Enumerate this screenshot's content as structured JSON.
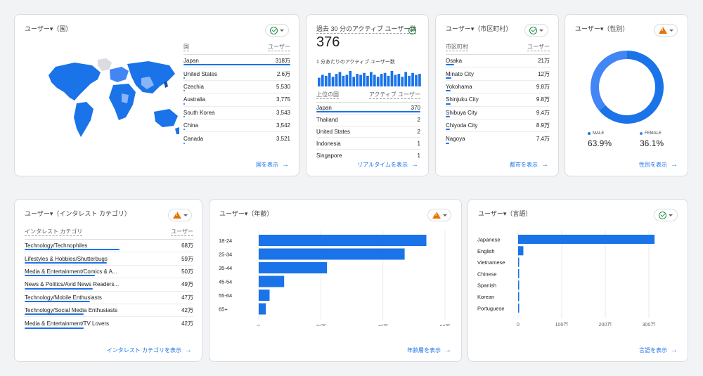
{
  "country_card": {
    "title": "ユーザー▾（国）",
    "header": [
      "国",
      "ユーザー"
    ],
    "rows": [
      {
        "name": "Japan",
        "value": "318万",
        "share": 1.0
      },
      {
        "name": "United States",
        "value": "2.6万",
        "share": 0.01
      },
      {
        "name": "Czechia",
        "value": "5,530",
        "share": 0.005
      },
      {
        "name": "Australia",
        "value": "3,775",
        "share": 0.005
      },
      {
        "name": "South Korea",
        "value": "3,543",
        "share": 0.005
      },
      {
        "name": "China",
        "value": "3,542",
        "share": 0.005
      },
      {
        "name": "Canada",
        "value": "3,521",
        "share": 0.005
      }
    ],
    "link": "国を表示",
    "status": "ok"
  },
  "realtime_card": {
    "title": "過去 30 分のアクティブ ユーザー数",
    "count": "376",
    "subtitle": "1 分あたりのアクティブ ユーザー数",
    "header": [
      "上位の国",
      "アクティブ ユーザー"
    ],
    "rows": [
      {
        "name": "Japan",
        "value": "370",
        "share": 1.0
      },
      {
        "name": "Thailand",
        "value": "2",
        "share": 0.01
      },
      {
        "name": "United States",
        "value": "2",
        "share": 0.01
      },
      {
        "name": "Indonesia",
        "value": "1",
        "share": 0.005
      },
      {
        "name": "Singapore",
        "value": "1",
        "share": 0.005
      }
    ],
    "minute_values": [
      9,
      12,
      11,
      14,
      10,
      13,
      15,
      11,
      12,
      16,
      10,
      13,
      12,
      14,
      11,
      15,
      12,
      10,
      13,
      14,
      11,
      16,
      12,
      13,
      10,
      15,
      11,
      14,
      12,
      13
    ],
    "link": "リアルタイムを表示",
    "status": "ok"
  },
  "city_card": {
    "title": "ユーザー▾（市区町村）",
    "header": [
      "市区町村",
      "ユーザー"
    ],
    "rows": [
      {
        "name": "Osaka",
        "value": "21万",
        "share": 0.07
      },
      {
        "name": "Minato City",
        "value": "12万",
        "share": 0.05
      },
      {
        "name": "Yokohama",
        "value": "9.8万",
        "share": 0.045
      },
      {
        "name": "Shinjuku City",
        "value": "9.8万",
        "share": 0.045
      },
      {
        "name": "Shibuya City",
        "value": "9.4万",
        "share": 0.04
      },
      {
        "name": "Chiyoda City",
        "value": "8.9万",
        "share": 0.04
      },
      {
        "name": "Nagoya",
        "value": "7.4万",
        "share": 0.035
      }
    ],
    "link": "都市を表示",
    "status": "ok"
  },
  "gender_card": {
    "title": "ユーザー▾（性別）",
    "segments": [
      {
        "label": "MALE",
        "value": "63.9%",
        "fraction": 0.639,
        "color": "#1a73e8"
      },
      {
        "label": "FEMALE",
        "value": "36.1%",
        "fraction": 0.361,
        "color": "#4285f4"
      }
    ],
    "link": "性別を表示",
    "status": "warn"
  },
  "interest_card": {
    "title": "ユーザー▾（インタレスト カテゴリ）",
    "header": [
      "インタレスト カテゴリ",
      "ユーザー"
    ],
    "rows": [
      {
        "name": "Technology/Technophiles",
        "value": "68万",
        "share": 1.0
      },
      {
        "name": "Lifestyles & Hobbies/Shutterbugs",
        "value": "59万",
        "share": 0.87
      },
      {
        "name": "Media & Entertainment/Comics & A...",
        "value": "50万",
        "share": 0.74
      },
      {
        "name": "News & Politics/Avid News Readers...",
        "value": "49万",
        "share": 0.72
      },
      {
        "name": "Technology/Mobile Enthusiasts",
        "value": "47万",
        "share": 0.69
      },
      {
        "name": "Technology/Social Media Enthusiasts",
        "value": "42万",
        "share": 0.62
      },
      {
        "name": "Media & Entertainment/TV Lovers",
        "value": "42万",
        "share": 0.62
      }
    ],
    "link": "インタレスト カテゴリを表示",
    "status": "warn"
  },
  "age_card": {
    "title": "ユーザー▾（年齢）",
    "link": "年齢層を表示",
    "status": "warn"
  },
  "language_card": {
    "title": "ユーザー▾（言語）",
    "link": "言語を表示",
    "status": "ok"
  },
  "chart_data": [
    {
      "type": "bar",
      "orientation": "horizontal",
      "categories": [
        "18-24",
        "25-34",
        "35-44",
        "45-54",
        "55-64",
        "65+"
      ],
      "values": [
        54,
        47,
        22,
        8.2,
        3.5,
        2.3
      ],
      "x_unit": "万",
      "xlim": [
        0,
        60
      ],
      "x_ticks": [
        "0",
        "20万",
        "40万",
        "60万"
      ],
      "grid": true
    },
    {
      "type": "bar",
      "orientation": "horizontal",
      "categories": [
        "Japanese",
        "English",
        "Vietnamese",
        "Chinese",
        "Spanish",
        "Korean",
        "Portuguese"
      ],
      "values": [
        313,
        12,
        1.5,
        1.2,
        1.0,
        0.8,
        0.6
      ],
      "x_unit": "万",
      "xlim": [
        0,
        300
      ],
      "x_ticks": [
        "0",
        "100万",
        "200万",
        "300万"
      ],
      "grid": true
    }
  ]
}
